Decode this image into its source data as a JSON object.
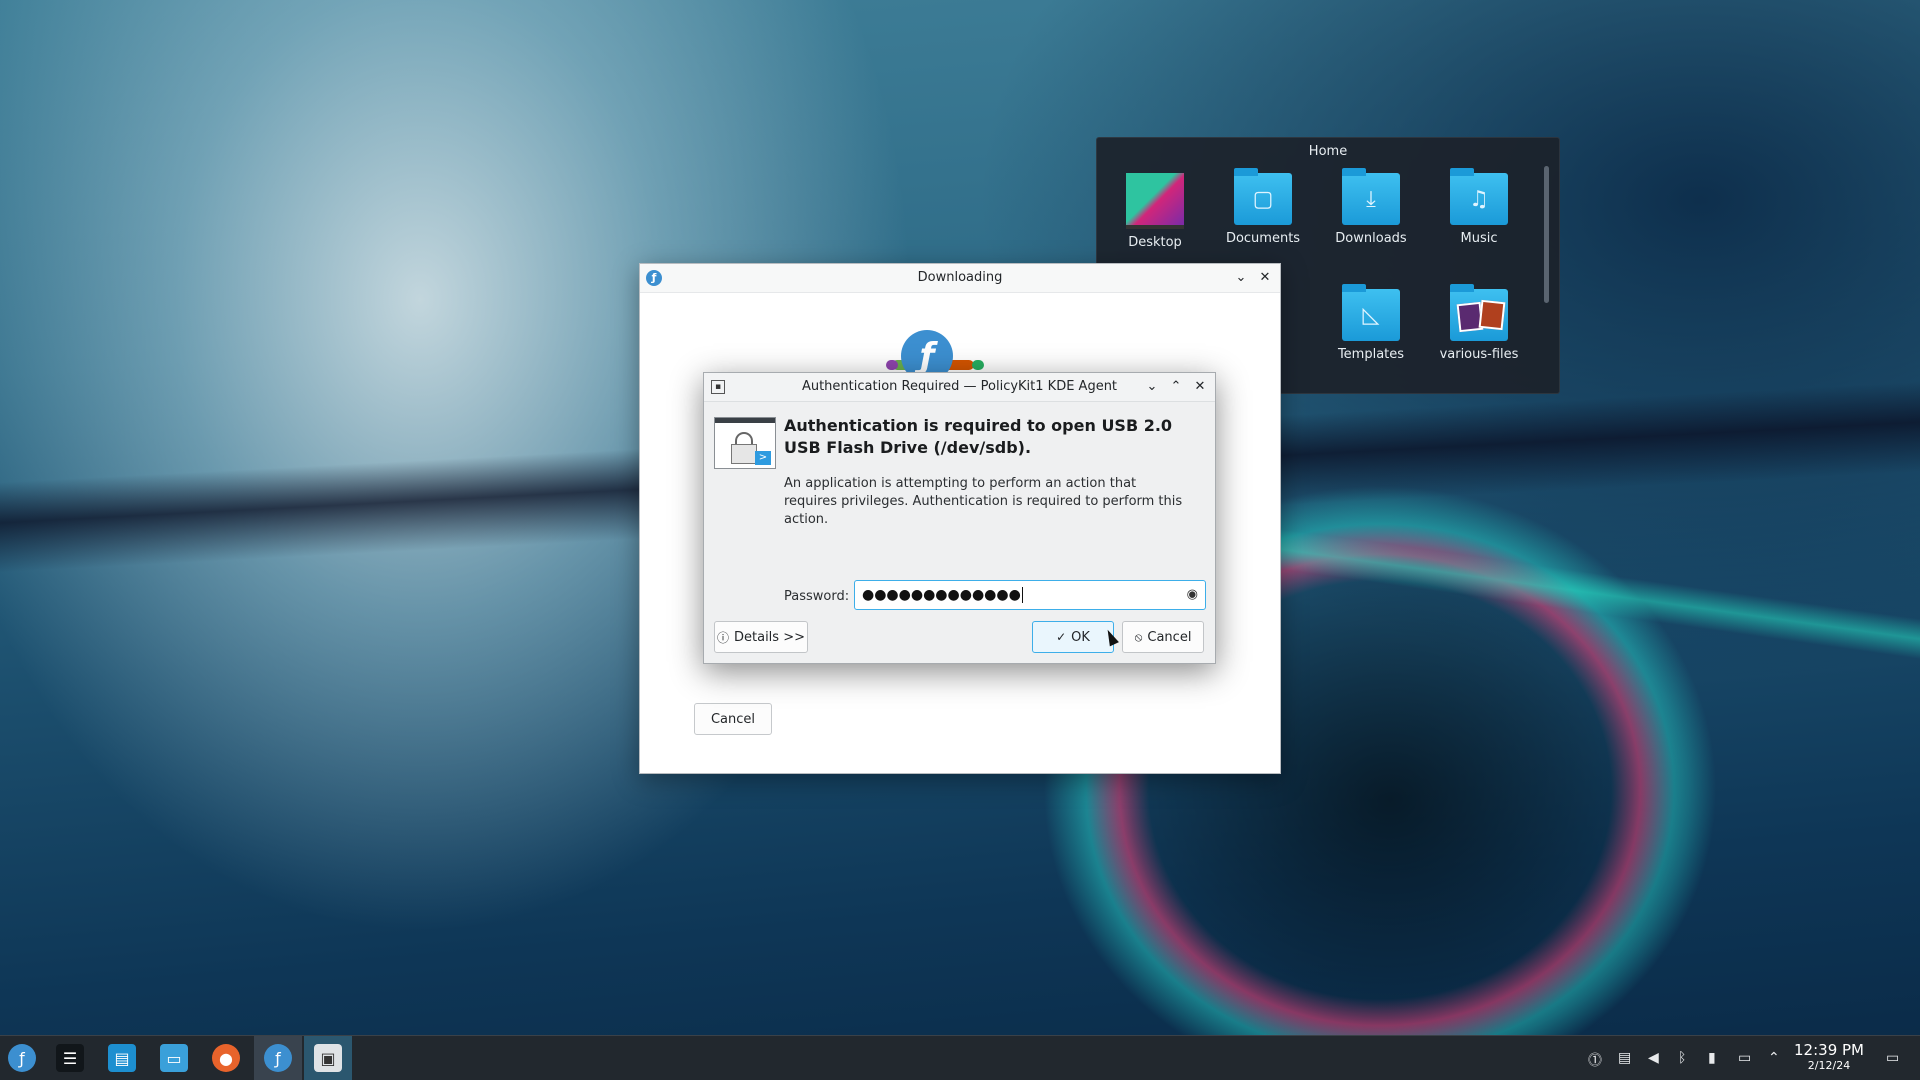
{
  "folder_view": {
    "title": "Home",
    "items": [
      {
        "label": "Desktop"
      },
      {
        "label": "Documents"
      },
      {
        "label": "Downloads"
      },
      {
        "label": "Music"
      },
      {
        "label": "Templates"
      },
      {
        "label": "various-files"
      }
    ]
  },
  "download_window": {
    "title": "Downloading",
    "cancel_label": "Cancel"
  },
  "auth_dialog": {
    "title": "Authentication Required — PolicyKit1 KDE Agent",
    "heading": "Authentication is required to open USB 2.0 USB Flash Drive (/dev/sdb).",
    "body": "An application is attempting to perform an action that requires privileges. Authentication is required to perform this action.",
    "password_label": "Password:",
    "password_value": "●●●●●●●●●●●●●",
    "details_label": "Details >>",
    "ok_label": "OK",
    "cancel_label": "Cancel"
  },
  "taskbar": {
    "time": "12:39 PM",
    "date": "2/12/24"
  },
  "colors": {
    "accent": "#3daee9",
    "taskbar_bg": "#22282e",
    "folder_blue": "#1b9ad8"
  }
}
